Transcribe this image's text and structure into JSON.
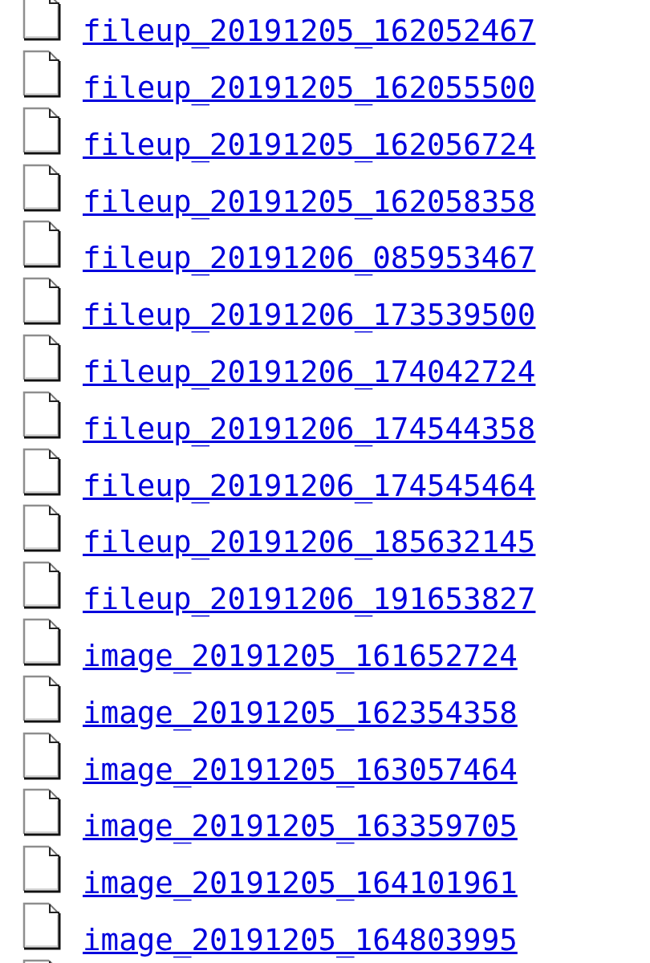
{
  "listing": {
    "files": [
      {
        "name": "fileup_20191205_162052467"
      },
      {
        "name": "fileup_20191205_162055500"
      },
      {
        "name": "fileup_20191205_162056724"
      },
      {
        "name": "fileup_20191205_162058358"
      },
      {
        "name": "fileup_20191206_085953467"
      },
      {
        "name": "fileup_20191206_173539500"
      },
      {
        "name": "fileup_20191206_174042724"
      },
      {
        "name": "fileup_20191206_174544358"
      },
      {
        "name": "fileup_20191206_174545464"
      },
      {
        "name": "fileup_20191206_185632145"
      },
      {
        "name": "fileup_20191206_191653827"
      },
      {
        "name": "image_20191205_161652724"
      },
      {
        "name": "image_20191205_162354358"
      },
      {
        "name": "image_20191205_163057464"
      },
      {
        "name": "image_20191205_163359705"
      },
      {
        "name": "image_20191205_164101961"
      },
      {
        "name": "image_20191205_164803995"
      }
    ],
    "more_rows_below": true
  }
}
